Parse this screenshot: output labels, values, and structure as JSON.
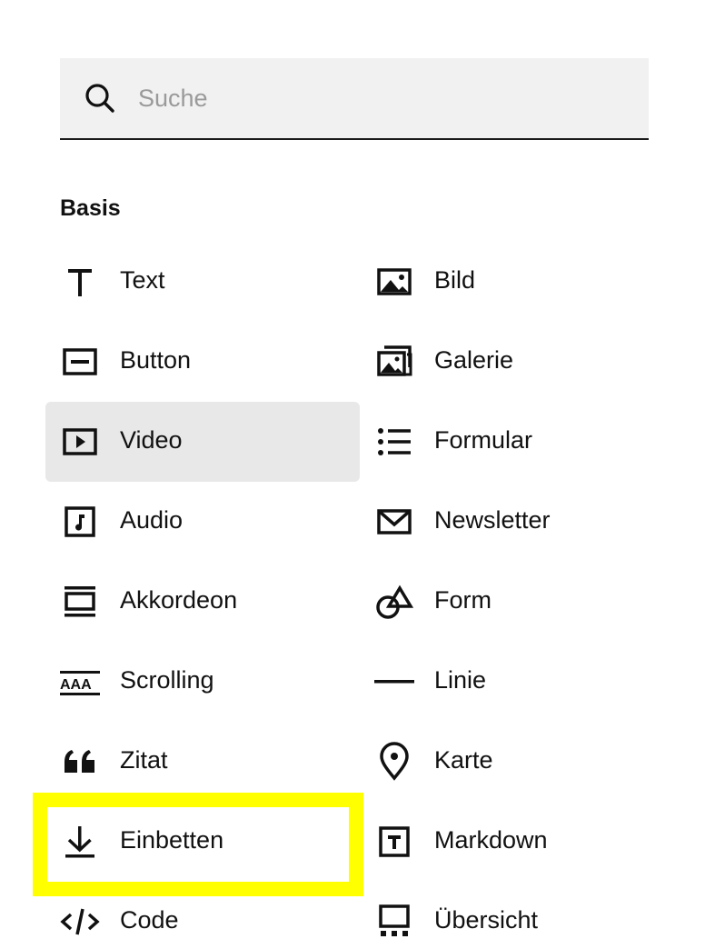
{
  "search": {
    "placeholder": "Suche",
    "value": ""
  },
  "section": {
    "title": "Basis"
  },
  "left_items": [
    {
      "label": "Text",
      "icon": "text-icon"
    },
    {
      "label": "Button",
      "icon": "button-icon"
    },
    {
      "label": "Video",
      "icon": "video-icon",
      "selected": true
    },
    {
      "label": "Audio",
      "icon": "audio-icon"
    },
    {
      "label": "Akkordeon",
      "icon": "accordion-icon"
    },
    {
      "label": "Scrolling",
      "icon": "scrolling-icon"
    },
    {
      "label": "Zitat",
      "icon": "quote-icon"
    },
    {
      "label": "Einbetten",
      "icon": "embed-download-icon",
      "highlighted": true
    },
    {
      "label": "Code",
      "icon": "code-icon"
    }
  ],
  "right_items": [
    {
      "label": "Bild",
      "icon": "image-icon"
    },
    {
      "label": "Galerie",
      "icon": "gallery-icon"
    },
    {
      "label": "Formular",
      "icon": "form-list-icon"
    },
    {
      "label": "Newsletter",
      "icon": "mail-icon"
    },
    {
      "label": "Form",
      "icon": "shape-icon"
    },
    {
      "label": "Linie",
      "icon": "line-icon"
    },
    {
      "label": "Karte",
      "icon": "map-pin-icon"
    },
    {
      "label": "Markdown",
      "icon": "markdown-icon"
    },
    {
      "label": "Übersicht",
      "icon": "summary-icon"
    }
  ],
  "colors": {
    "selected_bg": "#e8e8e8",
    "highlight": "#ffff00",
    "search_bg": "#f1f1f1"
  }
}
